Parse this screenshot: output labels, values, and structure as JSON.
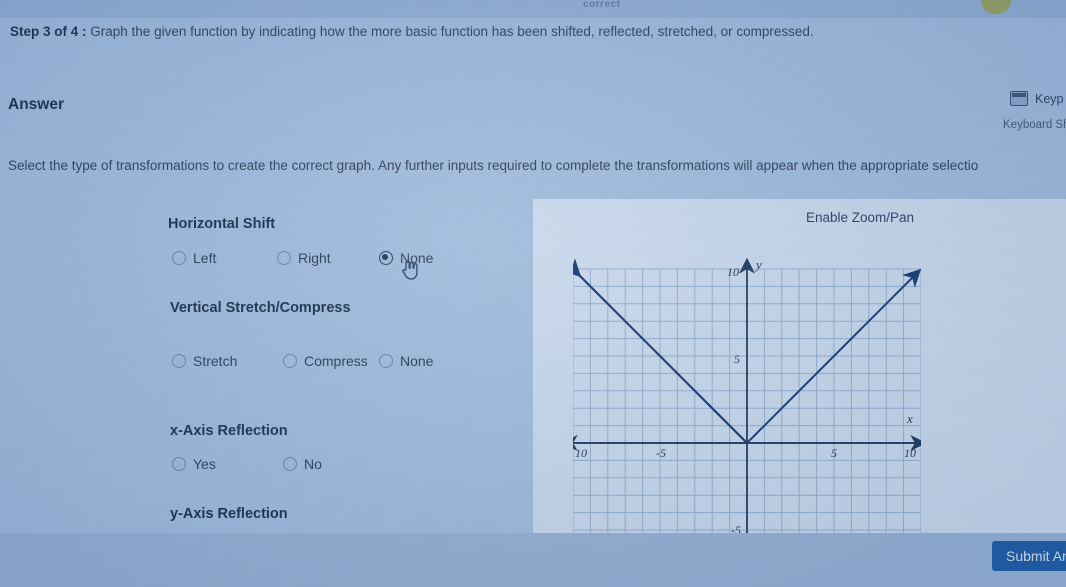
{
  "header": {
    "cutoff_top_text": "correct",
    "step_label": "Step 3 of 4 :",
    "step_text": "Graph the given function by indicating how the more basic function has been shifted, reflected, stretched, or compressed.",
    "answer_heading": "Answer",
    "keypad_label": "Keyp",
    "keyboard_shortcuts_label": "Keyboard Shor"
  },
  "instruction": "Select the type of transformations to create the correct graph. Any further inputs required to complete the transformations will appear when the appropriate selectio",
  "form": {
    "groups": [
      {
        "title": "Horizontal Shift",
        "options": [
          {
            "label": "Left",
            "selected": false
          },
          {
            "label": "Right",
            "selected": false
          },
          {
            "label": "None",
            "selected": true
          }
        ]
      },
      {
        "title": "Vertical Stretch/Compress",
        "options": [
          {
            "label": "Stretch",
            "selected": false
          },
          {
            "label": "Compress",
            "selected": false
          },
          {
            "label": "None",
            "selected": false
          }
        ]
      },
      {
        "title": "x-Axis Reflection",
        "options": [
          {
            "label": "Yes",
            "selected": false
          },
          {
            "label": "No",
            "selected": false
          }
        ]
      },
      {
        "title": "y-Axis Reflection",
        "options": []
      }
    ]
  },
  "graph": {
    "zoom_pan_label": "Enable Zoom/Pan",
    "x_axis_label": "x",
    "y_axis_label": "y",
    "x_ticks": [
      "10",
      "-5",
      "5",
      "10"
    ],
    "y_ticks": [
      "10",
      "5",
      "-5"
    ]
  },
  "chart_data": {
    "type": "line",
    "title": "",
    "xlabel": "x",
    "ylabel": "y",
    "xlim": [
      -10,
      10
    ],
    "ylim": [
      -5,
      10
    ],
    "grid": true,
    "legend": "none",
    "x_ticks": [
      -10,
      -5,
      5,
      10
    ],
    "y_ticks": [
      10,
      5,
      -5
    ],
    "series": [
      {
        "name": "y = |x|",
        "x": [
          -10,
          -5,
          0,
          5,
          10
        ],
        "values": [
          10,
          5,
          0,
          5,
          10
        ],
        "arrows": "both"
      }
    ]
  },
  "footer": {
    "submit_label": "Submit An"
  },
  "colors": {
    "accent": "#1f63ad",
    "curve": "#1b3a63",
    "panel": "#eef4fb",
    "page_bg": "#bcd2ea",
    "heading": "#16304d"
  }
}
